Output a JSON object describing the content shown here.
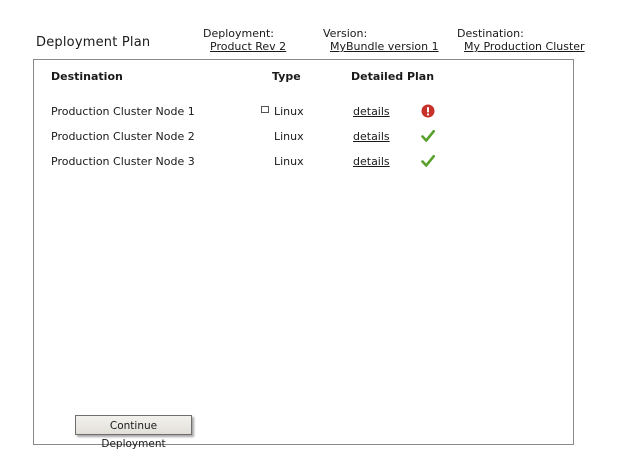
{
  "page": {
    "title": "Deployment Plan"
  },
  "meta": {
    "deployment": {
      "label": "Deployment:",
      "value": "Product Rev 2"
    },
    "version": {
      "label": "Version:",
      "value": "MyBundle version 1"
    },
    "destination": {
      "label": "Destination:",
      "value": "My Production Cluster"
    }
  },
  "table": {
    "headers": {
      "destination": "Destination",
      "type": "Type",
      "plan": "Detailed Plan"
    },
    "rows": [
      {
        "destination": "Production Cluster Node 1",
        "type": "Linux",
        "details": "details",
        "status": "error",
        "status_icon": "error-icon",
        "has_marker": true
      },
      {
        "destination": "Production Cluster Node 2",
        "type": "Linux",
        "details": "details",
        "status": "ok",
        "status_icon": "check-icon",
        "has_marker": false
      },
      {
        "destination": "Production Cluster Node 3",
        "type": "Linux",
        "details": "details",
        "status": "ok",
        "status_icon": "check-icon",
        "has_marker": false
      }
    ]
  },
  "actions": {
    "continue_label": "Continue Deployment"
  },
  "colors": {
    "error": "#c8302a",
    "ok": "#5aa02c",
    "panel_border": "#8a8a8a"
  }
}
